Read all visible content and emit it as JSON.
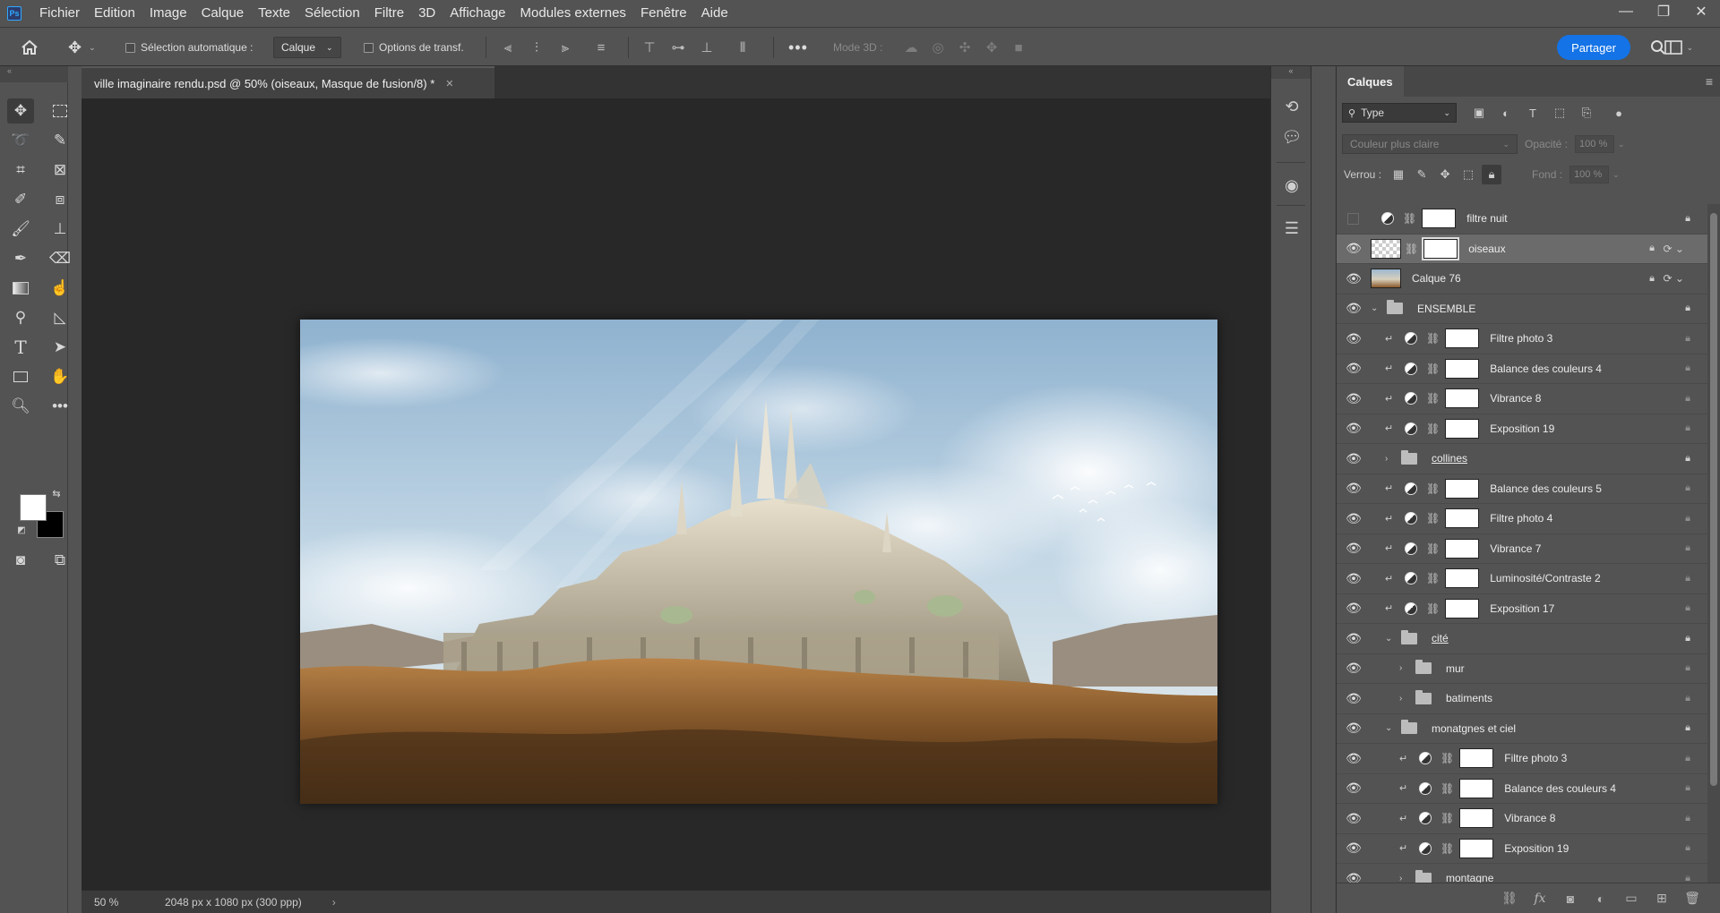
{
  "app": {
    "logo": "Ps"
  },
  "menu": [
    "Fichier",
    "Edition",
    "Image",
    "Calque",
    "Texte",
    "Sélection",
    "Filtre",
    "3D",
    "Affichage",
    "Modules externes",
    "Fenêtre",
    "Aide"
  ],
  "options": {
    "auto_select_label": "Sélection automatique :",
    "auto_select_target": "Calque",
    "transform_options_label": "Options de transf.",
    "mode3d_label": "Mode 3D :",
    "share_label": "Partager"
  },
  "document": {
    "tab_title": "ville imaginaire rendu.psd @ 50% (oiseaux, Masque de fusion/8) *",
    "zoom": "50 %",
    "info": "2048 px x 1080 px (300 ppp)"
  },
  "layers_panel": {
    "tab": "Calques",
    "filter_kind": "Type",
    "blend_mode": "Couleur plus claire",
    "opacity_label": "Opacité :",
    "opacity_value": "100 %",
    "lock_label": "Verrou :",
    "fill_label": "Fond :",
    "fill_value": "100 %",
    "layers": [
      {
        "name": "filtre nuit",
        "kind": "adjustment",
        "visible": false,
        "indent": 0,
        "locked": true
      },
      {
        "name": "oiseaux",
        "kind": "pixel-mask",
        "visible": true,
        "indent": 0,
        "selected": true,
        "locked": true
      },
      {
        "name": "Calque 76",
        "kind": "pixel",
        "visible": true,
        "indent": 0,
        "locked": true
      },
      {
        "name": "ENSEMBLE",
        "kind": "group-open",
        "visible": true,
        "indent": 0,
        "locked": true
      },
      {
        "name": "Filtre photo 3",
        "kind": "adjustment-clip",
        "visible": true,
        "indent": 1
      },
      {
        "name": "Balance des couleurs 4",
        "kind": "adjustment-clip",
        "visible": true,
        "indent": 1
      },
      {
        "name": "Vibrance 8",
        "kind": "adjustment-clip",
        "visible": true,
        "indent": 1
      },
      {
        "name": "Exposition 19",
        "kind": "adjustment-clip",
        "visible": true,
        "indent": 1
      },
      {
        "name": "collines",
        "kind": "group-closed",
        "visible": true,
        "indent": 1,
        "locked": true,
        "underline": true
      },
      {
        "name": "Balance des couleurs 5",
        "kind": "adjustment-clip",
        "visible": true,
        "indent": 1
      },
      {
        "name": "Filtre photo 4",
        "kind": "adjustment-clip",
        "visible": true,
        "indent": 1
      },
      {
        "name": "Vibrance 7",
        "kind": "adjustment-clip",
        "visible": true,
        "indent": 1
      },
      {
        "name": "Luminosité/Contraste 2",
        "kind": "adjustment-clip",
        "visible": true,
        "indent": 1
      },
      {
        "name": "Exposition 17",
        "kind": "adjustment-clip",
        "visible": true,
        "indent": 1
      },
      {
        "name": "cité",
        "kind": "group-open",
        "visible": true,
        "indent": 1,
        "locked": true,
        "underline": true
      },
      {
        "name": "mur",
        "kind": "group-closed",
        "visible": true,
        "indent": 2
      },
      {
        "name": "batiments",
        "kind": "group-closed",
        "visible": true,
        "indent": 2
      },
      {
        "name": "monatgnes et ciel",
        "kind": "group-open",
        "visible": true,
        "indent": 1,
        "locked": true
      },
      {
        "name": "Filtre photo 3",
        "kind": "adjustment-clip",
        "visible": true,
        "indent": 2
      },
      {
        "name": "Balance des couleurs 4",
        "kind": "adjustment-clip",
        "visible": true,
        "indent": 2
      },
      {
        "name": "Vibrance 8",
        "kind": "adjustment-clip",
        "visible": true,
        "indent": 2
      },
      {
        "name": "Exposition 19",
        "kind": "adjustment-clip",
        "visible": true,
        "indent": 2
      },
      {
        "name": "montagne",
        "kind": "group-closed",
        "visible": true,
        "indent": 2,
        "underline": true
      }
    ]
  },
  "colors": {
    "accent": "#1473e6",
    "bg": "#535353",
    "canvas_bg": "#282828"
  }
}
